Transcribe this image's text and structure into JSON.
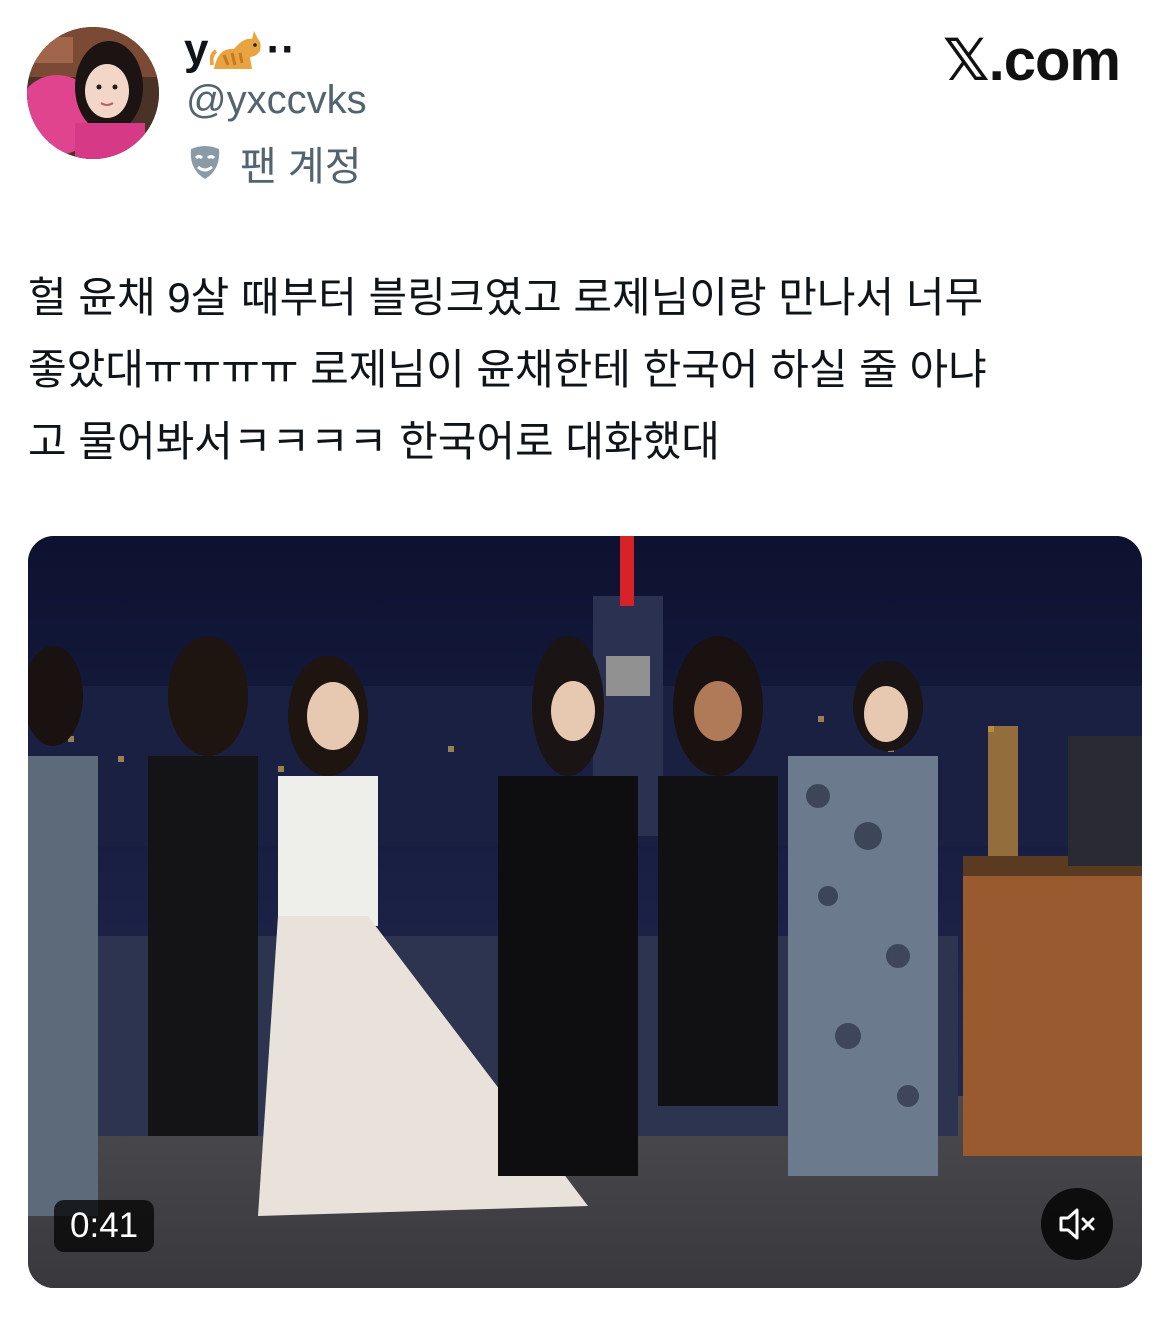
{
  "user": {
    "display_name": "y",
    "name_suffix": "··",
    "name_icon": "cat-emoji-icon",
    "handle": "@yxccvks",
    "account_label": "팬 계정",
    "account_label_icon": "mask-icon"
  },
  "brand": {
    "label": "𝕏.com"
  },
  "tweet": {
    "lines": [
      "헐 윤채 9살 때부터 블링크였고 로제님이랑 만나서 너무",
      "좋았대ㅠㅠㅠㅠ 로제님이 윤채한테 한국어 하실 줄 아냐",
      "고 물어봐서ㅋㅋㅋㅋ 한국어로 대화했대"
    ]
  },
  "video": {
    "timestamp": "0:41",
    "muted": true,
    "mute_icon": "speaker-muted-icon"
  },
  "colors": {
    "text": "#0f1419",
    "secondary": "#536471",
    "badge_bg": "#000000"
  }
}
